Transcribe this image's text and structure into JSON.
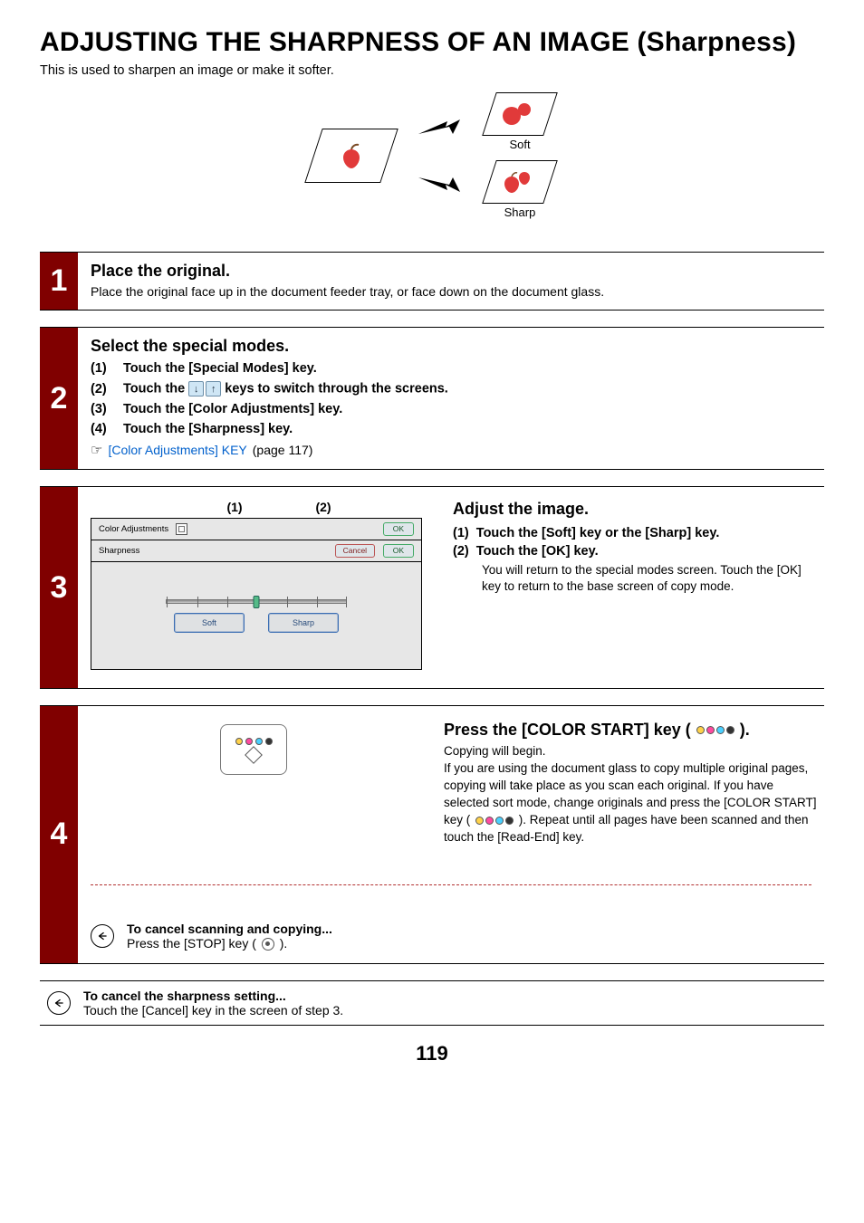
{
  "title": "ADJUSTING THE SHARPNESS OF AN IMAGE (Sharpness)",
  "intro": "This is used to sharpen an image or make it softer.",
  "illu": {
    "soft": "Soft",
    "sharp": "Sharp"
  },
  "step1": {
    "num": "1",
    "title": "Place the original.",
    "text": "Place the original face up in the document feeder tray, or face down on the document glass."
  },
  "step2": {
    "num": "2",
    "title": "Select the special modes.",
    "items": {
      "a": {
        "n": "(1)",
        "t": "Touch the [Special Modes] key."
      },
      "b": {
        "n": "(2)",
        "t1": "Touch the ",
        "t2": " keys to switch through the screens."
      },
      "c": {
        "n": "(3)",
        "t": "Touch the [Color Adjustments] key."
      },
      "d": {
        "n": "(4)",
        "t": "Touch the [Sharpness] key."
      }
    },
    "link": {
      "label": "[Color Adjustments] KEY",
      "page": " (page 117)"
    },
    "pointer": "☞"
  },
  "step3": {
    "num": "3",
    "callouts": {
      "a": "(1)",
      "b": "(2)"
    },
    "panel": {
      "header": "Color Adjustments",
      "row2": "Sharpness",
      "ok": "OK",
      "cancel": "Cancel",
      "soft": "Soft",
      "sharp": "Sharp"
    },
    "title": "Adjust the image.",
    "items": {
      "a": {
        "n": "(1)",
        "t": "Touch the [Soft] key or the [Sharp] key."
      },
      "b": {
        "n": "(2)",
        "t": "Touch the [OK] key."
      }
    },
    "note": "You will return to the special modes screen. Touch the [OK] key to return to the base screen of copy mode."
  },
  "step4": {
    "num": "4",
    "title1": "Press the [COLOR START] key (",
    "title2": ").",
    "line1": "Copying will begin.",
    "para1": "If you are using the document glass to copy multiple original pages, copying will take place as you scan each original. If you have selected sort mode, change originals and press the [COLOR START] key (",
    "para2": "). Repeat until all pages have been scanned and then touch the [Read-End] key.",
    "cancel_title": "To cancel scanning and copying...",
    "cancel_text1": "Press the [STOP] key (",
    "cancel_text2": ")."
  },
  "footer": {
    "title": "To cancel the sharpness setting...",
    "text": "Touch the [Cancel] key in the screen of step 3."
  },
  "page": "119"
}
